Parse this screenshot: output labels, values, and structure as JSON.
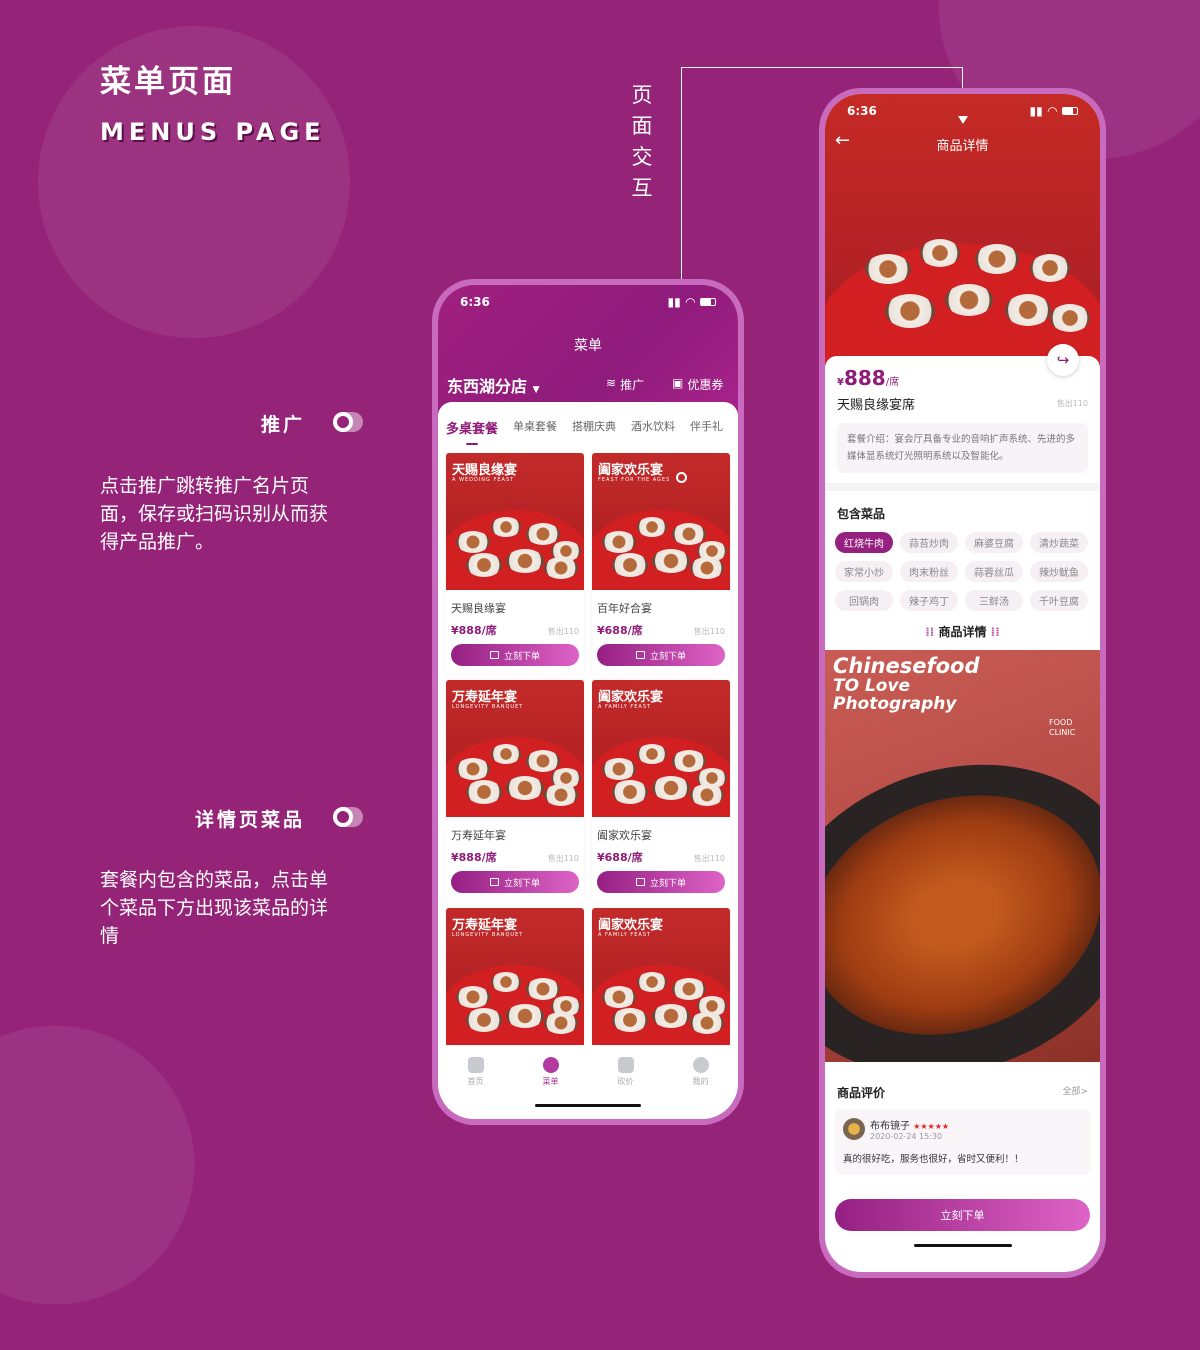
{
  "presentation": {
    "title_cn": "菜单页面",
    "title_en": "MENUS PAGE",
    "interaction_label": "页面交互",
    "notes": [
      {
        "label": "推广",
        "text": "点击推广跳转推广名片页面，保存或扫码识别从而获得产品推广。"
      },
      {
        "label": "详情页菜品",
        "text": "套餐内包含的菜品，点击单个菜品下方出现该菜品的详情"
      }
    ]
  },
  "colors": {
    "background": "#952478",
    "accent": "#8e1c78",
    "hero_red": "#c52a25"
  },
  "menu_screen": {
    "status_time": "6:36",
    "title": "菜单",
    "store": "东西湖分店",
    "promote": "推广",
    "coupon": "优惠券",
    "tabs": [
      "多桌套餐",
      "单桌套餐",
      "搭棚庆典",
      "酒水饮料",
      "伴手礼"
    ],
    "cards": [
      {
        "img_title": "天赐良缘宴",
        "img_sub": "A WEDDING FEAST",
        "name": "天赐良缘宴",
        "price": "¥888/席",
        "sold": "售出110",
        "button": "立刻下单"
      },
      {
        "img_title": "阖家欢乐宴",
        "img_sub": "FEAST FOR THE AGES",
        "name": "百年好合宴",
        "price": "¥688/席",
        "sold": "售出110",
        "button": "立刻下单"
      },
      {
        "img_title": "万寿延年宴",
        "img_sub": "LONGEVITY BANQUET",
        "name": "万寿延年宴",
        "price": "¥888/席",
        "sold": "售出110",
        "button": "立刻下单"
      },
      {
        "img_title": "阖家欢乐宴",
        "img_sub": "A FAMILY FEAST",
        "name": "阖家欢乐宴",
        "price": "¥688/席",
        "sold": "售出110",
        "button": "立刻下单"
      },
      {
        "img_title": "万寿延年宴",
        "img_sub": "LONGEVITY BANQUET"
      },
      {
        "img_title": "阖家欢乐宴",
        "img_sub": "A FAMILY FEAST"
      }
    ],
    "tabbar": [
      {
        "label": "首页",
        "icon": "home-icon"
      },
      {
        "label": "菜单",
        "icon": "menu-grid-icon",
        "active": true
      },
      {
        "label": "砍价",
        "icon": "bargain-icon"
      },
      {
        "label": "我的",
        "icon": "profile-icon"
      }
    ]
  },
  "detail_screen": {
    "status_time": "6:36",
    "title": "商品详情",
    "price_symbol": "¥",
    "price": "888",
    "price_unit": "/席",
    "name": "天赐良缘宴席",
    "sold": "售出110",
    "intro": "套餐介绍：宴会厅具备专业的音响扩声系统、先进的多媒体显系统灯光照明系统以及智能化。",
    "dishes_title": "包含菜品",
    "dishes": [
      "红烧牛肉",
      "蒜苔炒肉",
      "麻婆豆腐",
      "清炒蔬菜",
      "家常小炒",
      "肉末粉丝",
      "蒜蓉丝瓜",
      "辣炒鱿鱼",
      "回锅肉",
      "辣子鸡丁",
      "三鲜汤",
      "千叶豆腐"
    ],
    "detail_heading": "商品详情",
    "poster": {
      "line1": "Chinesefood",
      "line2": "TO Love",
      "line3": "Photography",
      "brand": "FOOD CLINIC"
    },
    "reviews_title": "商品评价",
    "reviews_all": "全部>",
    "review": {
      "user": "布布镜子",
      "rating": 5,
      "stars": "★★★★★",
      "date": "2020-02-24 15:30",
      "text": "真的很好吃，服务也很好，省时又便利！！"
    },
    "order_button": "立刻下单"
  }
}
